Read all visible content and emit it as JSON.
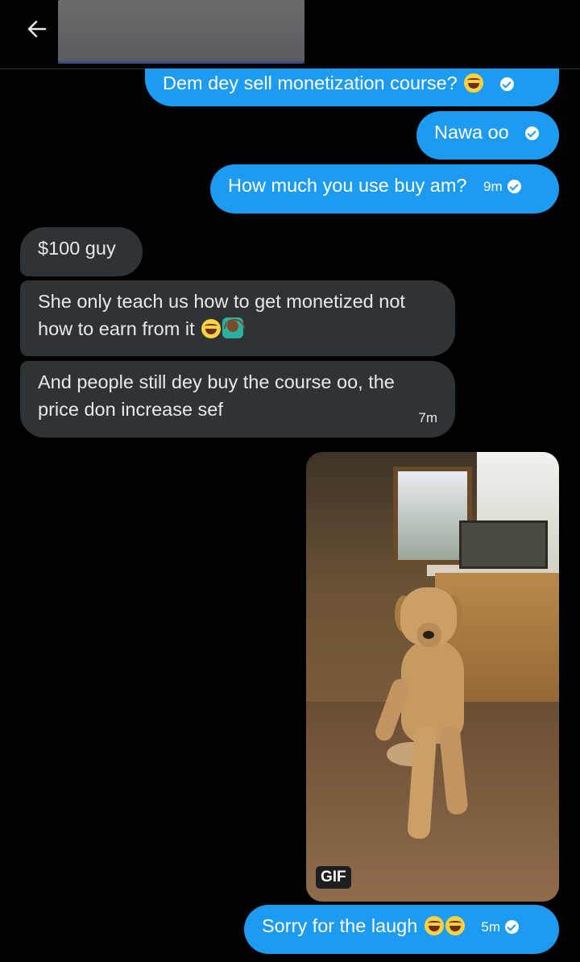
{
  "header": {
    "title": ""
  },
  "messages": [
    {
      "direction": "out",
      "text": "Dem dey sell monetization course?",
      "emoji": [
        "face-with-tears-of-joy"
      ],
      "time": "",
      "status": "seen"
    },
    {
      "direction": "out",
      "text": "Nawa oo",
      "emoji": [],
      "time": "",
      "status": "seen"
    },
    {
      "direction": "out",
      "text": "How much you use buy am?",
      "emoji": [],
      "time": "9m",
      "status": "seen"
    },
    {
      "direction": "in",
      "text": "$100 guy",
      "emoji": [],
      "time": ""
    },
    {
      "direction": "in",
      "text": "She only teach us how to get monetized not how to earn from it",
      "emoji": [
        "face-with-tears-of-joy",
        "person-gesturing-no"
      ],
      "time": ""
    },
    {
      "direction": "in",
      "text": "And people still dey buy the course oo, the price don increase sef",
      "emoji": [],
      "time": "7m"
    },
    {
      "direction": "out",
      "type": "gif",
      "badge": "GIF"
    },
    {
      "direction": "out",
      "text": "Sorry for the laugh",
      "emoji": [
        "face-with-tears-of-joy",
        "face-with-tears-of-joy"
      ],
      "time": "5m",
      "status": "seen"
    }
  ],
  "colors": {
    "outgoing_bubble": "#1d9bf0",
    "incoming_bubble": "#2f3336",
    "background": "#000000"
  }
}
